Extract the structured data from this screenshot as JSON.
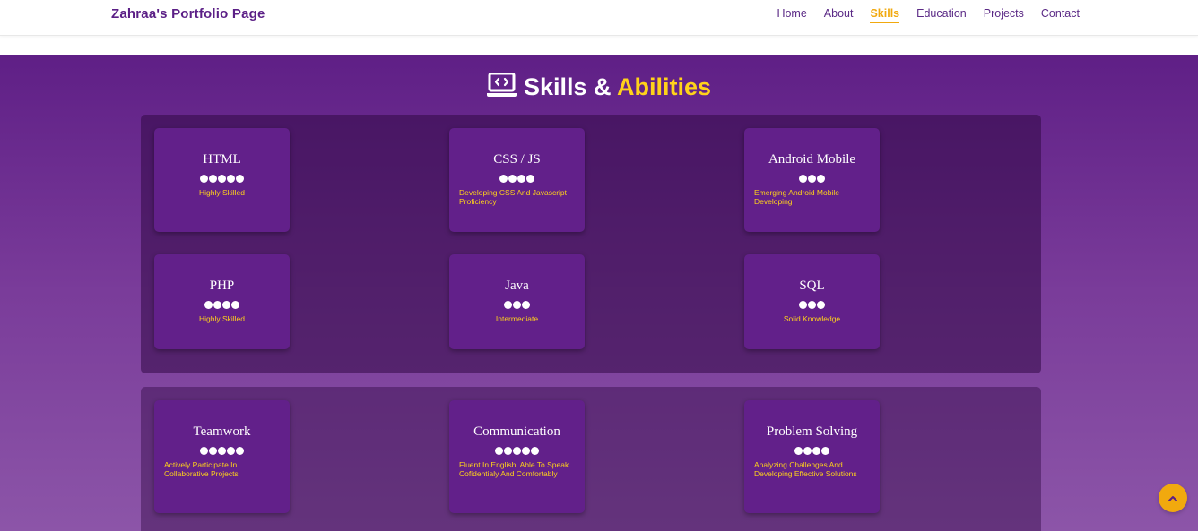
{
  "header": {
    "brand": "Zahraa's Portfolio Page",
    "nav": [
      "Home",
      "About",
      "Skills",
      "Education",
      "Projects",
      "Contact"
    ],
    "active": "Skills"
  },
  "skills": {
    "title_main": "Skills &",
    "title_accent": "Abilities",
    "icon": "laptop-code-icon",
    "accent_color": "#ffd21a",
    "technical": [
      {
        "name": "HTML",
        "level": 5,
        "desc": "Highly Skilled"
      },
      {
        "name": "CSS / JS",
        "level": 4,
        "desc": "Developing CSS And Javascript Proficiency"
      },
      {
        "name": "Android Mobile",
        "level": 3,
        "desc": "Emerging Android Mobile Developing"
      },
      {
        "name": "PHP",
        "level": 4,
        "desc": "Highly Skilled"
      },
      {
        "name": "Java",
        "level": 3,
        "desc": "Intermediate"
      },
      {
        "name": "SQL",
        "level": 3,
        "desc": "Solid Knowledge"
      }
    ],
    "soft": [
      {
        "name": "Teamwork",
        "level": 5,
        "desc": "Actively Participate In Collaborative Projects"
      },
      {
        "name": "Communication",
        "level": 5,
        "desc": "Fluent In English, Able To Speak Cofidentialy And Comfortably"
      },
      {
        "name": "Problem Solving",
        "level": 4,
        "desc": "Analyzing Challenges And Developing Effective Solutions"
      }
    ]
  },
  "scroll_top": {
    "icon": "chevron-up-icon",
    "color": "#f1a90e"
  }
}
